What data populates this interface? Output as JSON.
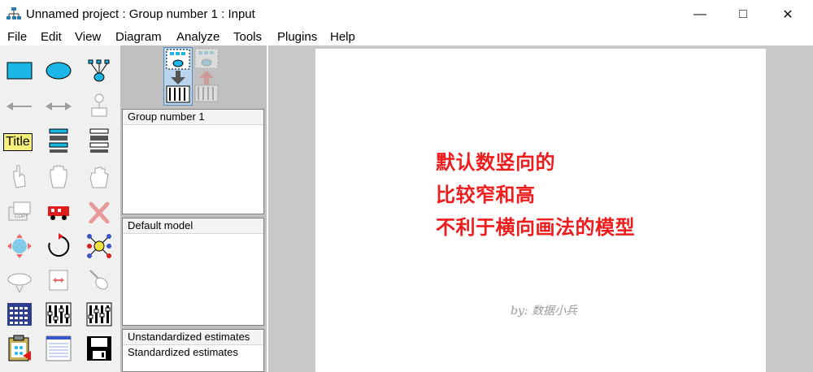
{
  "window": {
    "title": "Unnamed project : Group number 1 : Input"
  },
  "menu": [
    "File",
    "Edit",
    "View",
    "Diagram",
    "Analyze",
    "Tools",
    "Plugins",
    "Help"
  ],
  "toolbox": {
    "title_tool_label": "Title",
    "icons": [
      "rectangle-icon",
      "ellipse-icon",
      "indicator-icon",
      "single-arrow-icon",
      "double-arrow-icon",
      "unique-variable-icon",
      "title-icon",
      "list-variables-icon",
      "list-data-variables-icon",
      "select-one-hand-icon",
      "select-all-hand-icon",
      "deselect-hand-icon",
      "duplicate-icon",
      "move-icon",
      "erase-icon",
      "resize-icon",
      "rotate-icon",
      "reflect-icon",
      "move-parameters-icon",
      "scroll-icon",
      "touch-up-icon",
      "data-file-icon",
      "analysis-properties-icon",
      "calculate-estimates-icon",
      "copy-clipboard-icon",
      "view-text-icon",
      "save-icon"
    ]
  },
  "views": {
    "input_icon": "input-path-diagram-icon",
    "output_icon": "output-path-diagram-icon"
  },
  "groups": {
    "items": [
      "Group number 1"
    ]
  },
  "models": {
    "items": [
      "Default model"
    ]
  },
  "estimates": {
    "items": [
      "Unstandardized estimates",
      "Standardized estimates"
    ]
  },
  "canvas": {
    "note_lines": [
      "默认数竖向的",
      "比较窄和高",
      "不利于横向画法的模型"
    ],
    "watermark": "by: 数据小兵"
  },
  "colors": {
    "accent": "#ee1c1c",
    "toolbox_bg": "#f0f0f0",
    "shape_fill": "#19b6e6"
  }
}
